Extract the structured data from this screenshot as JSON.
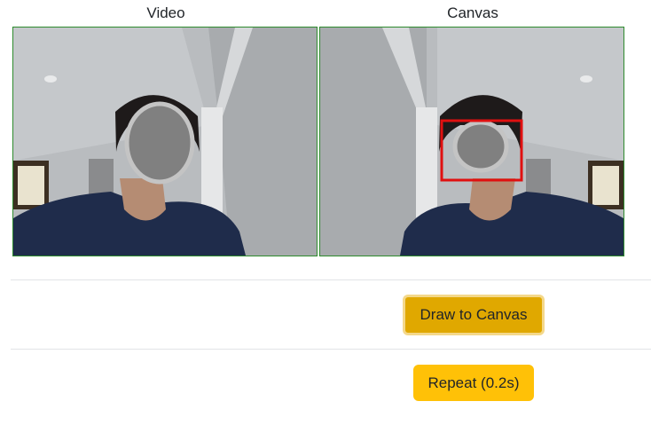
{
  "panels": {
    "video_label": "Video",
    "canvas_label": "Canvas"
  },
  "buttons": {
    "draw": "Draw to Canvas",
    "repeat": "Repeat (0.2s)"
  },
  "colors": {
    "frame_border": "#2e8b2e",
    "detection_box": "#e01010",
    "button_active": "#e0a800",
    "button_warning": "#ffc107"
  }
}
